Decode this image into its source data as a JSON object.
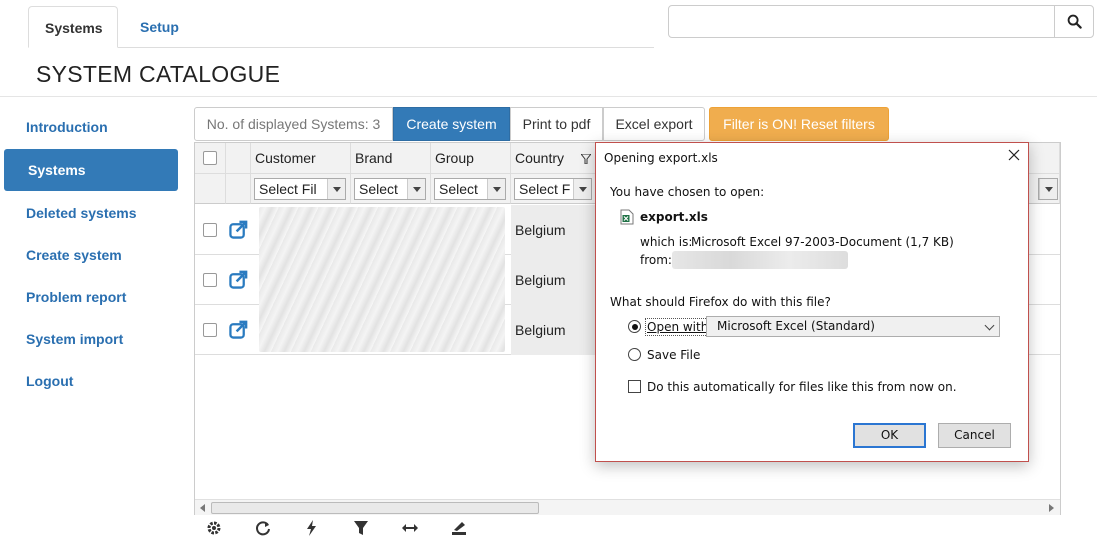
{
  "tabs": [
    {
      "label": "Systems",
      "active": true
    },
    {
      "label": "Setup",
      "active": false
    }
  ],
  "search": {
    "placeholder": ""
  },
  "page_title": "SYSTEM CATALOGUE",
  "sidebar": {
    "items": [
      {
        "label": "Introduction"
      },
      {
        "label": "Systems",
        "active": true
      },
      {
        "label": "Deleted systems"
      },
      {
        "label": "Create system"
      },
      {
        "label": "Problem report"
      },
      {
        "label": "System import"
      },
      {
        "label": "Logout"
      }
    ]
  },
  "toolbar": {
    "count_label": "No. of displayed Systems: 3",
    "create_label": "Create system",
    "pdf_label": "Print to pdf",
    "excel_label": "Excel export",
    "filter_label": "Filter is ON! Reset filters",
    "filter_color": "#f0ad4e",
    "primary_color": "#337ab7"
  },
  "grid": {
    "columns": [
      "Customer",
      "Brand",
      "Group",
      "Country"
    ],
    "filters": [
      "Select Fil",
      "Select",
      "Select",
      "Select F"
    ],
    "rows": [
      {
        "country": "Belgium"
      },
      {
        "country": "Belgium"
      },
      {
        "country": "Belgium"
      }
    ],
    "row_icon": "external-link-icon"
  },
  "footer_icons": [
    "gear-icon",
    "refresh-icon",
    "bolt-icon",
    "filter-icon",
    "resize-horizontal-icon",
    "export-icon"
  ],
  "dialog": {
    "title": "Opening export.xls",
    "intro": "You have chosen to open:",
    "file_name": "export.xls",
    "which_is_label": "which is:",
    "which_is_value": "Microsoft Excel 97-2003-Document (1,7 KB)",
    "from_label": "from:",
    "question": "What should Firefox do with this file?",
    "open_with_label": "Open with",
    "open_with_value": "Microsoft Excel (Standard)",
    "save_file_label": "Save File",
    "auto_label": "Do this automatically for files like this from now on.",
    "ok_label": "OK",
    "cancel_label": "Cancel"
  }
}
